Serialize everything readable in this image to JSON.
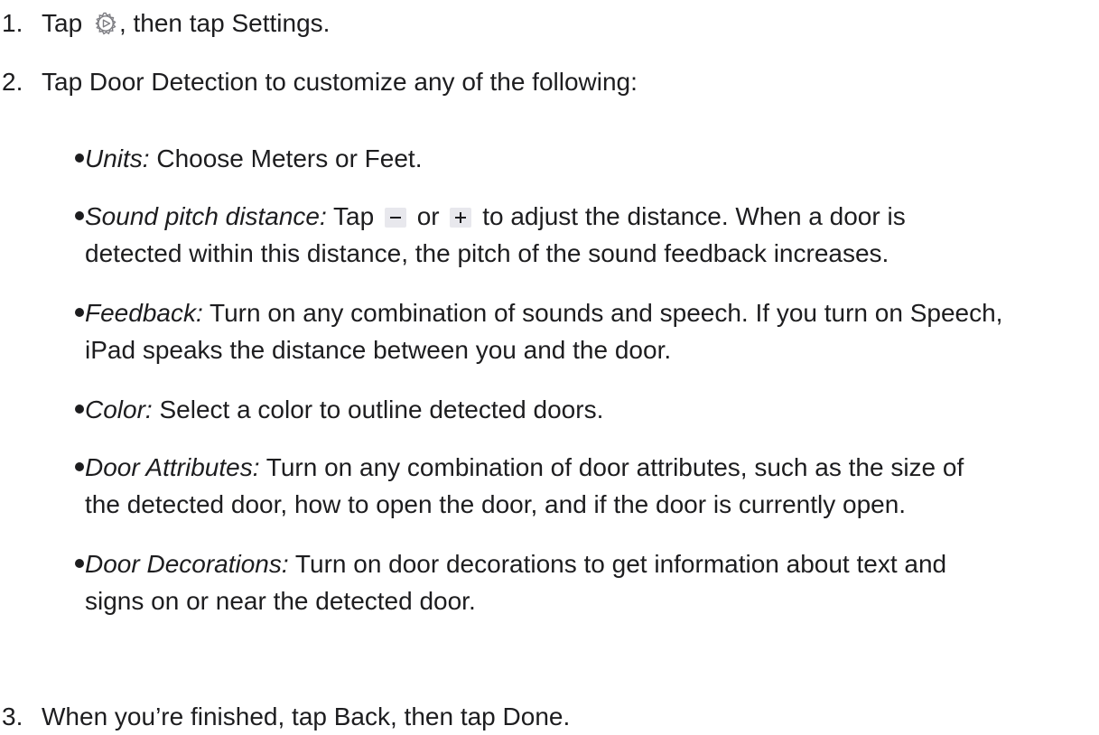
{
  "steps": [
    {
      "number": "1.",
      "before_icon": "Tap ",
      "icon": "gear-icon",
      "after_icon": ", then tap Settings."
    },
    {
      "number": "2.",
      "text": "Tap Door Detection to customize any of the following:"
    },
    {
      "number": "3.",
      "text": "When you’re finished, tap Back, then tap Done."
    }
  ],
  "bullets": [
    {
      "term": "Units:",
      "text": " Choose Meters or Feet."
    },
    {
      "term": "Sound pitch distance:",
      "text_before_minus": " Tap ",
      "minus_icon": "minus-icon",
      "text_between": " or ",
      "plus_icon": "plus-icon",
      "line1_end": " to adjust the distance. When a door is",
      "line2": "detected within this distance, the pitch of the sound feedback increases."
    },
    {
      "term": "Feedback:",
      "line1": " Turn on any combination of sounds and speech. If you turn on Speech,",
      "line2": "iPad speaks the distance between you and the door."
    },
    {
      "term": "Color:",
      "text": " Select a color to outline detected doors."
    },
    {
      "term": "Door Attributes:",
      "line1": " Turn on any combination of door attributes, such as the size of",
      "line2": "the detected door, how to open the door, and if the door is currently open."
    },
    {
      "term": "Door Decorations:",
      "line1": " Turn on door decorations to get information about text and",
      "line2": "signs on or near the detected door."
    }
  ],
  "colors": {
    "text": "#1d1d1f",
    "icon_button_bg": "#e8e8ed"
  }
}
